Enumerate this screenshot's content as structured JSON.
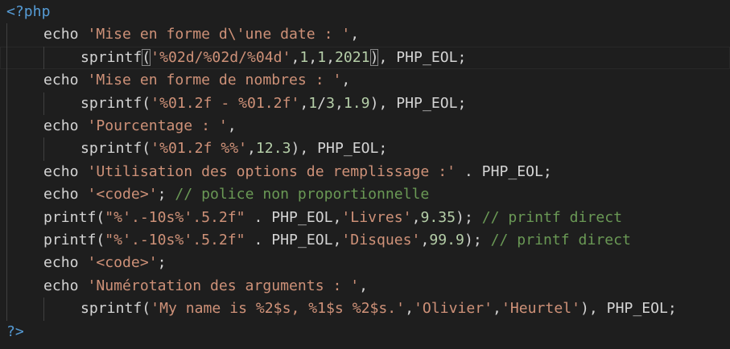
{
  "editor": {
    "language": "php",
    "lines": [
      {
        "indent": 0,
        "tokens": [
          {
            "t": "tag",
            "v": "<?php"
          }
        ]
      },
      {
        "indent": 1,
        "tokens": [
          {
            "t": "kw",
            "v": "echo "
          },
          {
            "t": "str",
            "v": "'Mise en forme d\\'une date : '"
          },
          {
            "t": "plain",
            "v": ","
          }
        ]
      },
      {
        "indent": 2,
        "current": true,
        "tokens": [
          {
            "t": "kw",
            "v": "sprintf"
          },
          {
            "t": "plain",
            "v": "(",
            "match": true
          },
          {
            "t": "str",
            "v": "'%02d/%02d/%04d'"
          },
          {
            "t": "plain",
            "v": ","
          },
          {
            "t": "num",
            "v": "1"
          },
          {
            "t": "plain",
            "v": ","
          },
          {
            "t": "num",
            "v": "1"
          },
          {
            "t": "plain",
            "v": ","
          },
          {
            "t": "num",
            "v": "2021"
          },
          {
            "t": "plain",
            "v": ")",
            "match": true
          },
          {
            "t": "plain",
            "v": ", PHP_EOL;"
          }
        ]
      },
      {
        "indent": 1,
        "tokens": [
          {
            "t": "kw",
            "v": "echo "
          },
          {
            "t": "str",
            "v": "'Mise en forme de nombres : '"
          },
          {
            "t": "plain",
            "v": ","
          }
        ]
      },
      {
        "indent": 2,
        "tokens": [
          {
            "t": "kw",
            "v": "sprintf"
          },
          {
            "t": "plain",
            "v": "("
          },
          {
            "t": "str",
            "v": "'%01.2f - %01.2f'"
          },
          {
            "t": "plain",
            "v": ","
          },
          {
            "t": "num",
            "v": "1"
          },
          {
            "t": "plain",
            "v": "/"
          },
          {
            "t": "num",
            "v": "3"
          },
          {
            "t": "plain",
            "v": ","
          },
          {
            "t": "num",
            "v": "1.9"
          },
          {
            "t": "plain",
            "v": "), PHP_EOL;"
          }
        ]
      },
      {
        "indent": 1,
        "tokens": [
          {
            "t": "kw",
            "v": "echo "
          },
          {
            "t": "str",
            "v": "'Pourcentage : '"
          },
          {
            "t": "plain",
            "v": ","
          }
        ]
      },
      {
        "indent": 2,
        "tokens": [
          {
            "t": "kw",
            "v": "sprintf"
          },
          {
            "t": "plain",
            "v": "("
          },
          {
            "t": "str",
            "v": "'%01.2f %%'"
          },
          {
            "t": "plain",
            "v": ","
          },
          {
            "t": "num",
            "v": "12.3"
          },
          {
            "t": "plain",
            "v": "), PHP_EOL;"
          }
        ]
      },
      {
        "indent": 1,
        "tokens": [
          {
            "t": "kw",
            "v": "echo "
          },
          {
            "t": "str",
            "v": "'Utilisation des options de remplissage :'"
          },
          {
            "t": "plain",
            "v": " . PHP_EOL;"
          }
        ]
      },
      {
        "indent": 1,
        "tokens": [
          {
            "t": "kw",
            "v": "echo "
          },
          {
            "t": "str",
            "v": "'<code>'"
          },
          {
            "t": "plain",
            "v": "; "
          },
          {
            "t": "cmt",
            "v": "// police non proportionnelle"
          }
        ]
      },
      {
        "indent": 1,
        "tokens": [
          {
            "t": "kw",
            "v": "printf"
          },
          {
            "t": "plain",
            "v": "("
          },
          {
            "t": "str",
            "v": "\"%'.-10s%'.5.2f\""
          },
          {
            "t": "plain",
            "v": " . PHP_EOL,"
          },
          {
            "t": "str",
            "v": "'Livres'"
          },
          {
            "t": "plain",
            "v": ","
          },
          {
            "t": "num",
            "v": "9.35"
          },
          {
            "t": "plain",
            "v": "); "
          },
          {
            "t": "cmt",
            "v": "// printf direct"
          }
        ]
      },
      {
        "indent": 1,
        "tokens": [
          {
            "t": "kw",
            "v": "printf"
          },
          {
            "t": "plain",
            "v": "("
          },
          {
            "t": "str",
            "v": "\"%'.-10s%'.5.2f\""
          },
          {
            "t": "plain",
            "v": " . PHP_EOL,"
          },
          {
            "t": "str",
            "v": "'Disques'"
          },
          {
            "t": "plain",
            "v": ","
          },
          {
            "t": "num",
            "v": "99.9"
          },
          {
            "t": "plain",
            "v": "); "
          },
          {
            "t": "cmt",
            "v": "// printf direct"
          }
        ]
      },
      {
        "indent": 1,
        "tokens": [
          {
            "t": "kw",
            "v": "echo "
          },
          {
            "t": "str",
            "v": "'<code>'"
          },
          {
            "t": "plain",
            "v": ";"
          }
        ]
      },
      {
        "indent": 1,
        "tokens": [
          {
            "t": "kw",
            "v": "echo "
          },
          {
            "t": "str",
            "v": "'Numérotation des arguments : '"
          },
          {
            "t": "plain",
            "v": ","
          }
        ]
      },
      {
        "indent": 2,
        "tokens": [
          {
            "t": "kw",
            "v": "sprintf"
          },
          {
            "t": "plain",
            "v": "("
          },
          {
            "t": "str",
            "v": "'My name is %2$s, %1$s %2$s.'"
          },
          {
            "t": "plain",
            "v": ","
          },
          {
            "t": "str",
            "v": "'Olivier'"
          },
          {
            "t": "plain",
            "v": ","
          },
          {
            "t": "str",
            "v": "'Heurtel'"
          },
          {
            "t": "plain",
            "v": "), PHP_EOL;"
          }
        ]
      },
      {
        "indent": 0,
        "tokens": [
          {
            "t": "tag",
            "v": "?>"
          }
        ]
      }
    ]
  },
  "colors": {
    "background": "#1e1e1e",
    "tag": "#569cd6",
    "keyword": "#d4d4d4",
    "string": "#ce9178",
    "number": "#b5cea8",
    "comment": "#6a9955",
    "plain": "#d4d4d4"
  }
}
